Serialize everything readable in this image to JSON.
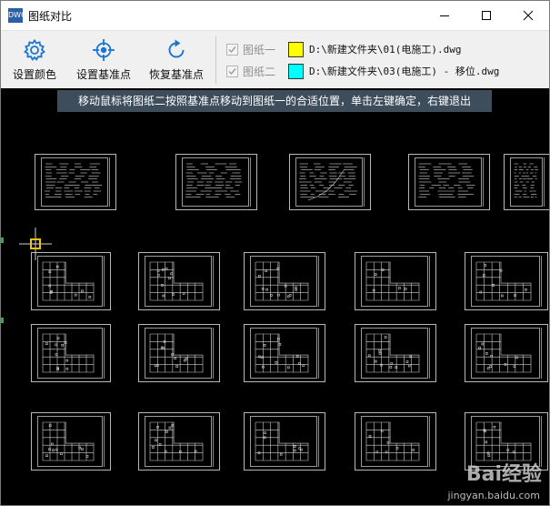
{
  "window": {
    "title": "图纸对比",
    "app_icon_text": "DWG"
  },
  "toolbar": {
    "set_color_label": "设置颜色",
    "set_base_label": "设置基准点",
    "restore_base_label": "恢复基准点",
    "accent_color": "#1a74d6"
  },
  "drawings": {
    "drawing1": {
      "label": "图纸一",
      "checked": true,
      "color": "#ffff00",
      "path": "D:\\新建文件夹\\01(电施工).dwg"
    },
    "drawing2": {
      "label": "图纸二",
      "checked": true,
      "color": "#00ffff",
      "path": "D:\\新建文件夹\\03(电施工) - 移位.dwg"
    }
  },
  "canvas": {
    "hint": "移动鼠标将图纸二按照基准点移动到图纸一的合适位置，单击左键确定，右键退出",
    "cursor_color": "#f5c400"
  },
  "watermark": {
    "text": "Bai经验",
    "url": "jingyan.baidu.com"
  }
}
